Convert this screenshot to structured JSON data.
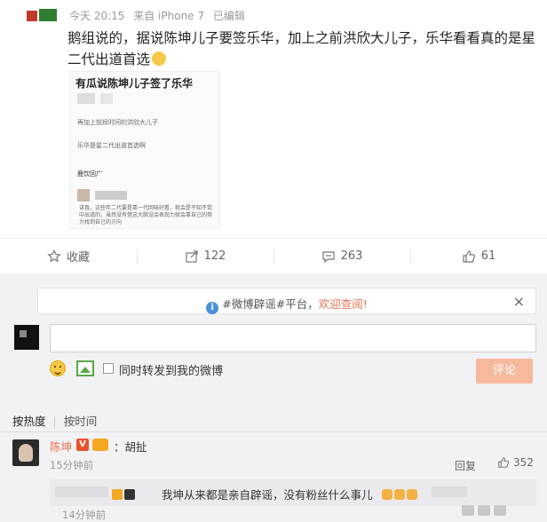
{
  "post": {
    "meta": {
      "time": "今天 20:15",
      "source": "来自 iPhone 7",
      "edited": "已编辑"
    },
    "text": "鹅组说的，据说陈坤儿子要签乐华，加上之前洪欣大儿子，乐华看看真的是星二代出道首选",
    "embedded": {
      "title": "有瓜说陈坤儿子签了乐华",
      "line1": "再加上前段时间的洪欣大儿子",
      "line2": "乐华是星二代出道首选啊",
      "tag": "鹿饮回广",
      "small": "讲真，这些年二代要是靠一代回味好看，就会是不知不觉中出道的，虽然没有借这大腕没会表现力就会靠自己的努力找到自己的方向"
    }
  },
  "actions": {
    "favorite_label": "收藏",
    "repost_count": "122",
    "comment_count": "263",
    "like_count": "61"
  },
  "notice": {
    "prefix": "#微博辟谣#平台，",
    "highlight": "欢迎查阅!",
    "close": "×"
  },
  "composer": {
    "input_value": "",
    "repost_checkbox_label": "同时转发到我的微博",
    "submit_label": "评论"
  },
  "sort": {
    "hot": "按热度",
    "time": "按时间"
  },
  "comments": [
    {
      "name": "陈坤",
      "verified": "V",
      "text": "：胡扯",
      "time": "15分钟前",
      "reply_label": "回复",
      "likes": "352",
      "reply": {
        "text": "我坤从来都是亲自辟谣，没有粉丝什么事儿",
        "time": "14分钟前"
      }
    }
  ],
  "colors": {
    "accent": "#eb7350",
    "submit_disabled": "#f7b99c",
    "verified": "#e8502d",
    "info": "#4a90d9"
  },
  "icons": [
    "star-icon",
    "repost-icon",
    "comment-icon",
    "thumb-up-icon",
    "info-icon",
    "close-icon",
    "emoji-icon",
    "image-icon"
  ]
}
